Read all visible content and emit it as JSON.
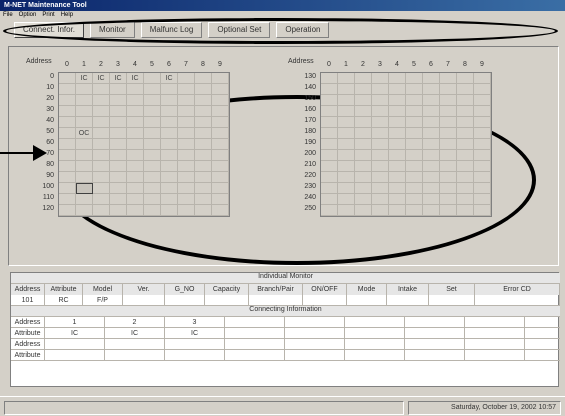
{
  "window": {
    "title": "M-NET Maintenance Tool"
  },
  "menu": [
    "File",
    "Option",
    "Print",
    "Help"
  ],
  "tabs": [
    {
      "label": "Connect. Infor.",
      "active": true
    },
    {
      "label": "Monitor",
      "active": false
    },
    {
      "label": "Malfunc Log",
      "active": false
    },
    {
      "label": "Optional Set",
      "active": false
    },
    {
      "label": "Operation",
      "active": false
    }
  ],
  "left_grid": {
    "header_label": "Address",
    "columns": [
      "0",
      "1",
      "2",
      "3",
      "4",
      "5",
      "6",
      "7",
      "8",
      "9"
    ],
    "rows": [
      "0",
      "10",
      "20",
      "30",
      "40",
      "50",
      "60",
      "70",
      "80",
      "90",
      "100",
      "110",
      "120"
    ],
    "marks": [
      {
        "row": "0",
        "col": "1",
        "text": "IC"
      },
      {
        "row": "0",
        "col": "2",
        "text": "IC"
      },
      {
        "row": "0",
        "col": "3",
        "text": "IC"
      },
      {
        "row": "0",
        "col": "4",
        "text": "IC"
      },
      {
        "row": "0",
        "col": "6",
        "text": "IC"
      },
      {
        "row": "50",
        "col": "1",
        "text": "OC"
      },
      {
        "row": "100",
        "col": "1",
        "text": "",
        "selected": true
      }
    ]
  },
  "right_grid": {
    "header_label": "Address",
    "columns": [
      "0",
      "1",
      "2",
      "3",
      "4",
      "5",
      "6",
      "7",
      "8",
      "9"
    ],
    "rows": [
      "130",
      "140",
      "150",
      "160",
      "170",
      "180",
      "190",
      "200",
      "210",
      "220",
      "230",
      "240",
      "250"
    ]
  },
  "individual_monitor": {
    "title": "Individual Monitor",
    "headers": [
      "Address",
      "Attribute",
      "Model",
      "Ver.",
      "G_NO",
      "Capacity",
      "Branch/Pair",
      "ON/OFF",
      "Mode",
      "Intake",
      "Set",
      "Error CD"
    ],
    "values": [
      "101",
      "RC",
      "F/P",
      "",
      "",
      "",
      "",
      "",
      "",
      "",
      "",
      ""
    ]
  },
  "connecting_info": {
    "title": "Connecting Information",
    "rows": [
      {
        "label": "Address",
        "values": [
          "1",
          "2",
          "3"
        ]
      },
      {
        "label": "Attribute",
        "values": [
          "IC",
          "IC",
          "IC"
        ]
      },
      {
        "label": "Address",
        "values": [
          "",
          "",
          ""
        ]
      },
      {
        "label": "Attribute",
        "values": [
          "",
          "",
          ""
        ]
      }
    ]
  },
  "status": {
    "datetime": "Saturday, October 19, 2002 10:57"
  }
}
